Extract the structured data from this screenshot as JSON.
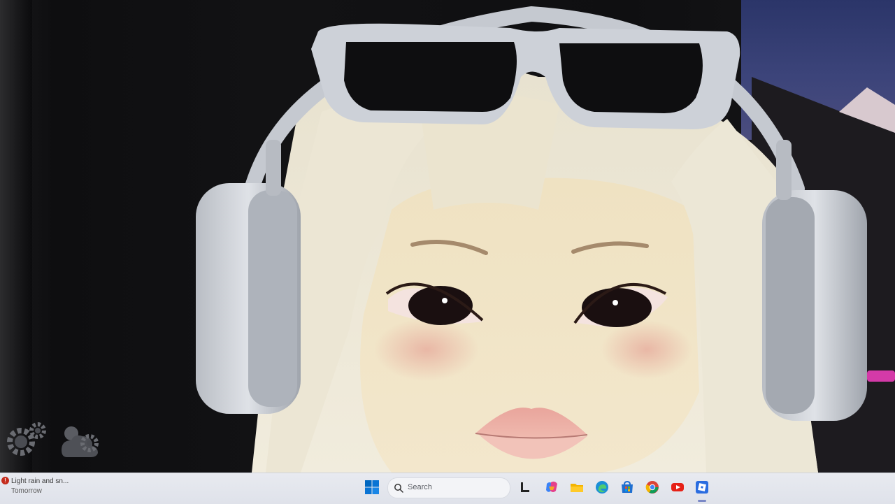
{
  "screen": {
    "game_buttons": [
      {
        "icon": "settings-gear-icon"
      },
      {
        "icon": "weather-settings-icon"
      }
    ]
  },
  "taskbar": {
    "weather": {
      "alert_badge": "!",
      "line1": "Light rain and sn...",
      "line2": "Tomorrow"
    },
    "search": {
      "placeholder": "Search"
    },
    "apps": [
      {
        "name": "task-view-icon"
      },
      {
        "name": "copilot-icon"
      },
      {
        "name": "file-explorer-icon"
      },
      {
        "name": "edge-browser-icon"
      },
      {
        "name": "microsoft-store-icon"
      },
      {
        "name": "chrome-icon"
      },
      {
        "name": "youtube-icon"
      },
      {
        "name": "roblox-icon"
      }
    ]
  },
  "colors": {
    "taskbar_bg": "#e8eaf0",
    "accent": "#0067c0",
    "alert": "#c42b1c"
  }
}
